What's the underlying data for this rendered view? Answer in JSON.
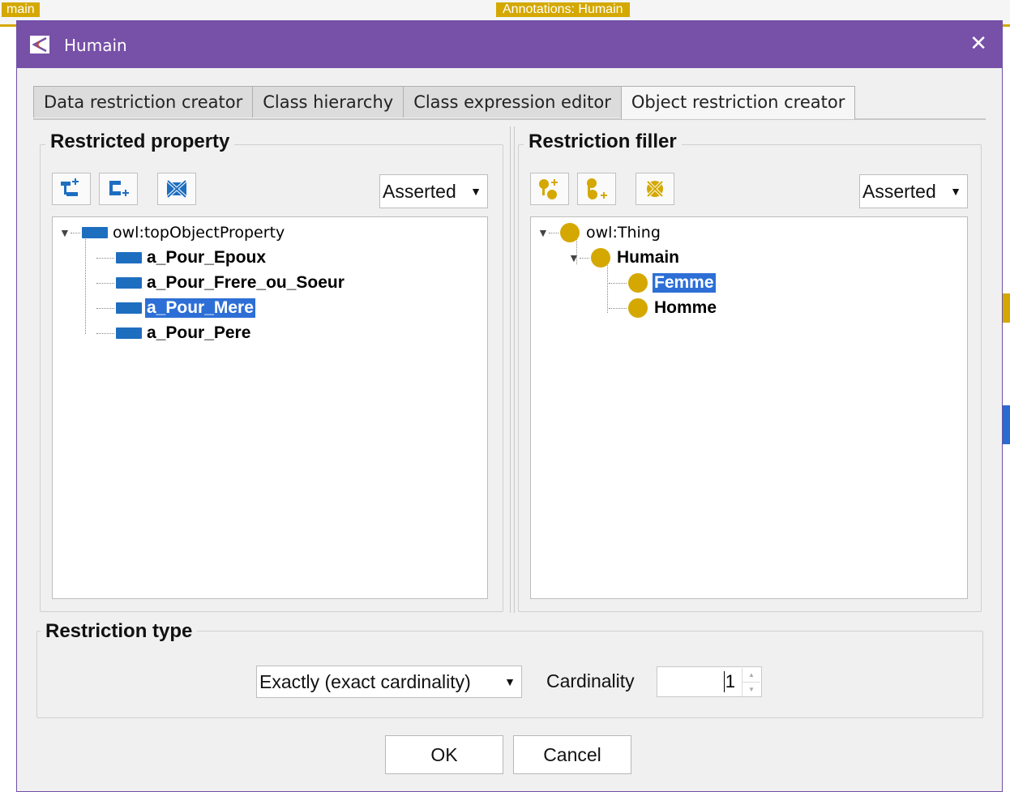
{
  "background": {
    "left_fragment": "main",
    "right_fragment": "Annotations: Humain"
  },
  "dialog": {
    "title": "Humain",
    "close_glyph": "✕"
  },
  "tabs": [
    {
      "label": "Data restriction creator"
    },
    {
      "label": "Class hierarchy"
    },
    {
      "label": "Class expression editor"
    },
    {
      "label": "Object restriction creator"
    }
  ],
  "restricted_property": {
    "title": "Restricted property",
    "view_select": "Asserted",
    "root": "owl:topObjectProperty",
    "items": [
      "a_Pour_Epoux",
      "a_Pour_Frere_ou_Soeur",
      "a_Pour_Mere",
      "a_Pour_Pere"
    ],
    "selected": "a_Pour_Mere"
  },
  "restriction_filler": {
    "title": "Restriction filler",
    "view_select": "Asserted",
    "root": "owl:Thing",
    "parent": "Humain",
    "children": [
      "Femme",
      "Homme"
    ],
    "selected": "Femme"
  },
  "restriction_type": {
    "title": "Restriction type",
    "type_select": "Exactly (exact cardinality)",
    "cardinality_label": "Cardinality",
    "cardinality_value": "1"
  },
  "buttons": {
    "ok": "OK",
    "cancel": "Cancel"
  },
  "colors": {
    "titlebar": "#7750a8",
    "property_icon": "#1e6ec0",
    "class_icon": "#d4a800",
    "selection": "#2d6fd6"
  }
}
